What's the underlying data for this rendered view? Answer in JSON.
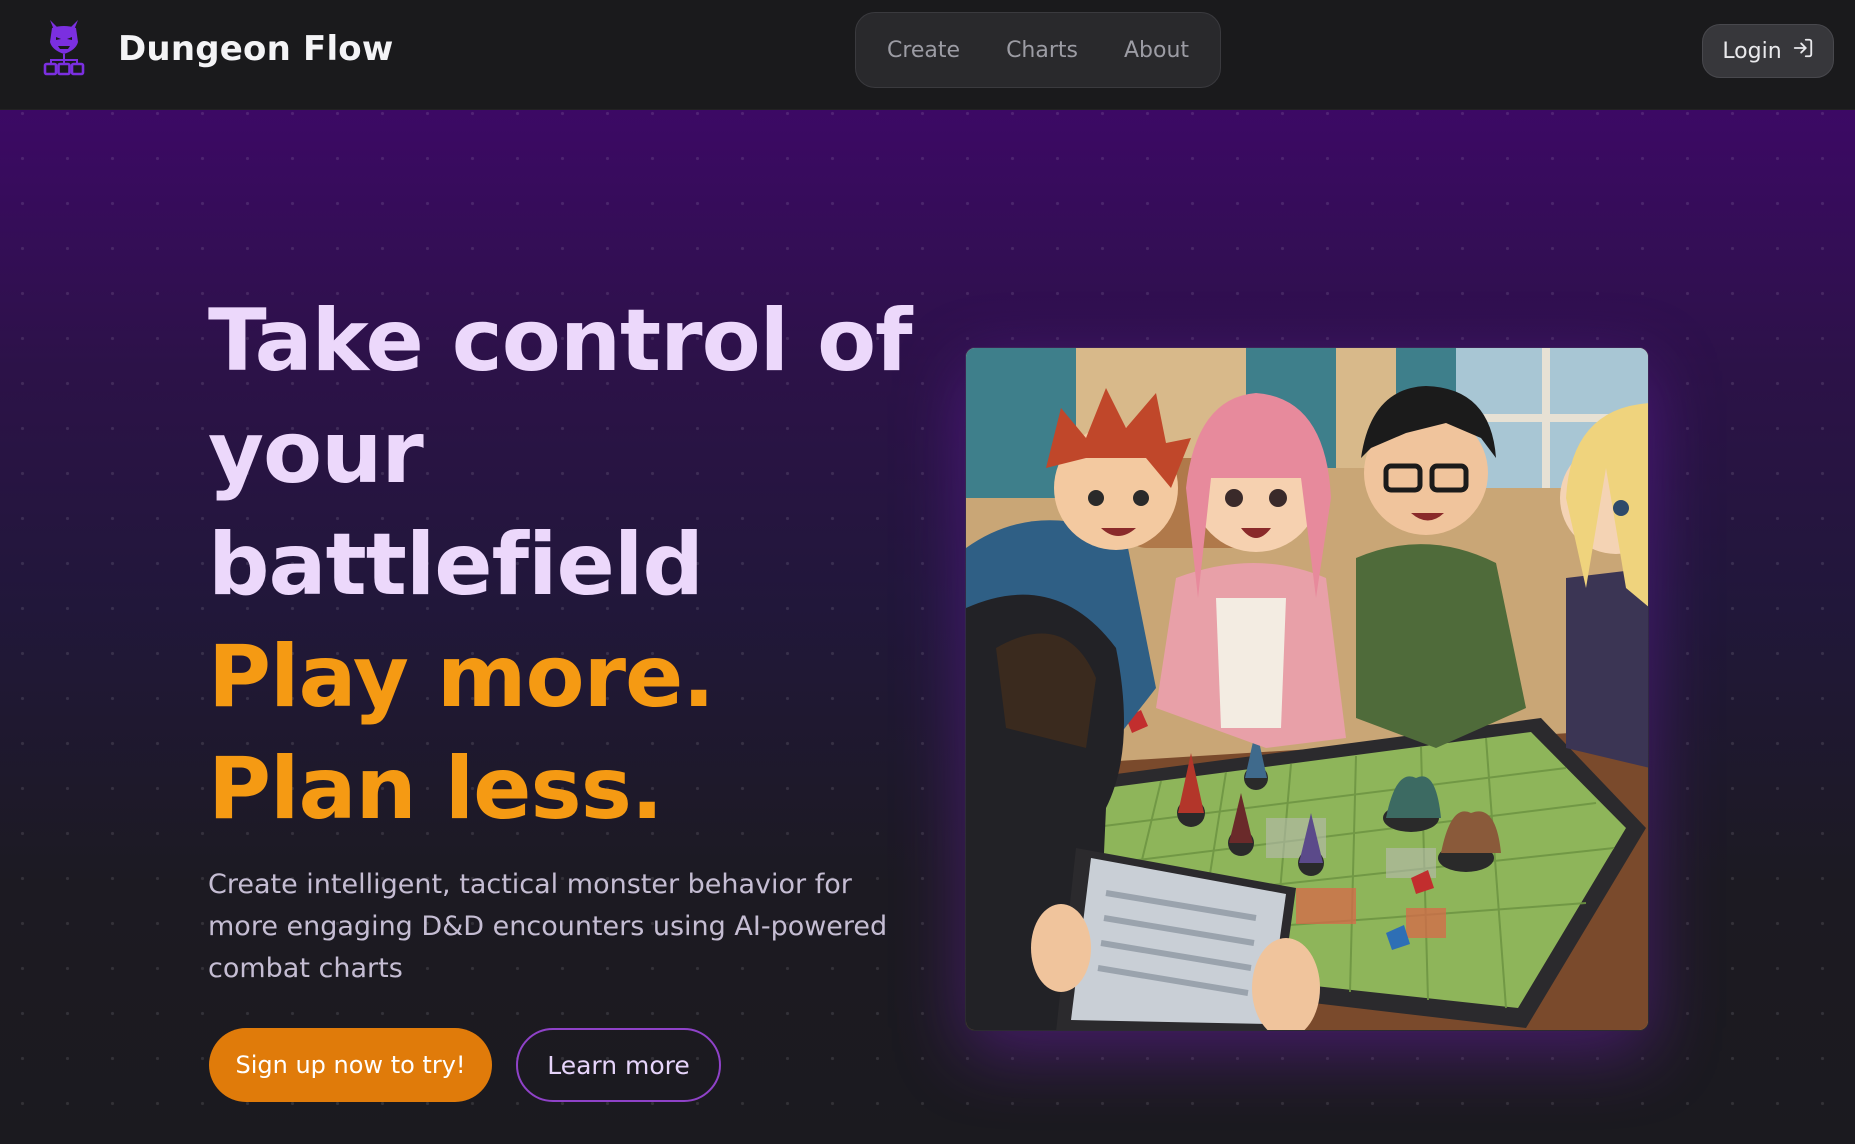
{
  "brand": {
    "name": "Dungeon Flow",
    "logo_icon": "demon-flowchart-icon",
    "logo_color": "#7b2fe0"
  },
  "nav": {
    "links": [
      {
        "label": "Create"
      },
      {
        "label": "Charts"
      },
      {
        "label": "About"
      }
    ],
    "login_label": "Login",
    "login_icon": "sign-in-icon"
  },
  "hero": {
    "headline_lines": [
      "Take control of",
      "your",
      "battlefield"
    ],
    "accent_lines": [
      "Play more.",
      "Plan less."
    ],
    "description": "Create intelligent, tactical monster behavior for more engaging D&D encounters using AI-powered combat charts",
    "primary_cta": "Sign up now to try!",
    "secondary_cta": "Learn more",
    "illustration_icon": "friends-playing-dnd-illustration"
  },
  "colors": {
    "accent_orange": "#f59a13",
    "button_orange": "#e07b0a",
    "headline_lavender": "#ecd8fb",
    "hero_top_purple": "#3c0965",
    "outline_purple": "#8f42c8"
  }
}
